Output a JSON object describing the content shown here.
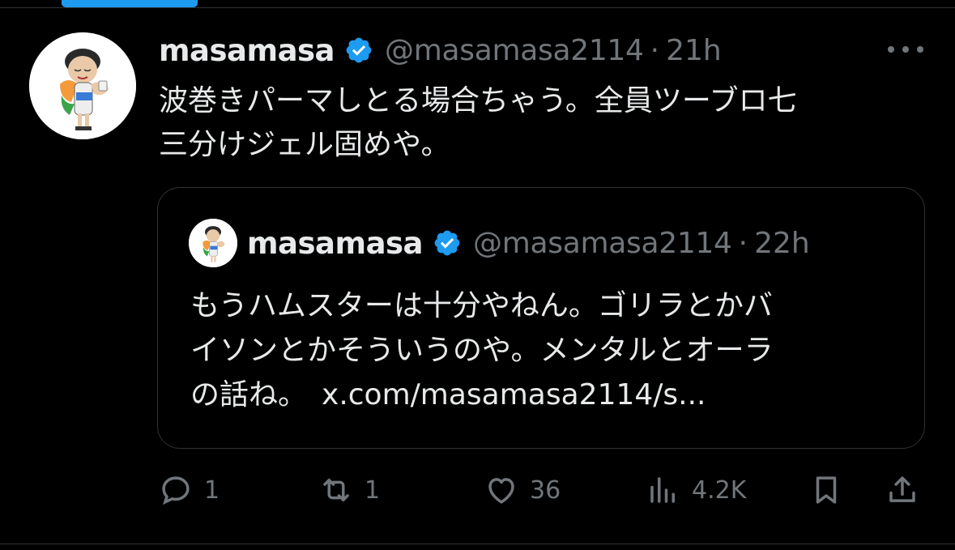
{
  "post": {
    "author_name": "masamasa",
    "handle": "@masamasa2114",
    "separator": "·",
    "time": "21h",
    "text_line1": "波巻きパーマしとる場合ちゃう。全員ツーブロ七",
    "text_line2": "三分けジェル固めや。"
  },
  "quote": {
    "author_name": "masamasa",
    "handle": "@masamasa2114",
    "separator": "·",
    "time": "22h",
    "line1": "もうハムスターは十分やねん。ゴリラとかバ",
    "line2": "イソンとかそういうのや。メンタルとオーラ",
    "line3_text": "の話ね。",
    "link": "x.com/masamasa2114/s..."
  },
  "actions": {
    "replies": "1",
    "reposts": "1",
    "likes": "36",
    "views": "4.2K"
  },
  "icons": {
    "verified": "verified-badge-icon",
    "more": "more-icon",
    "reply": "reply-icon",
    "repost": "repost-icon",
    "like": "heart-icon",
    "views": "views-icon",
    "bookmark": "bookmark-icon",
    "share": "share-icon"
  },
  "colors": {
    "background": "#000000",
    "text": "#e7e9ea",
    "secondary": "#71767b",
    "accent": "#1d9bf0",
    "border": "#2f3336"
  }
}
